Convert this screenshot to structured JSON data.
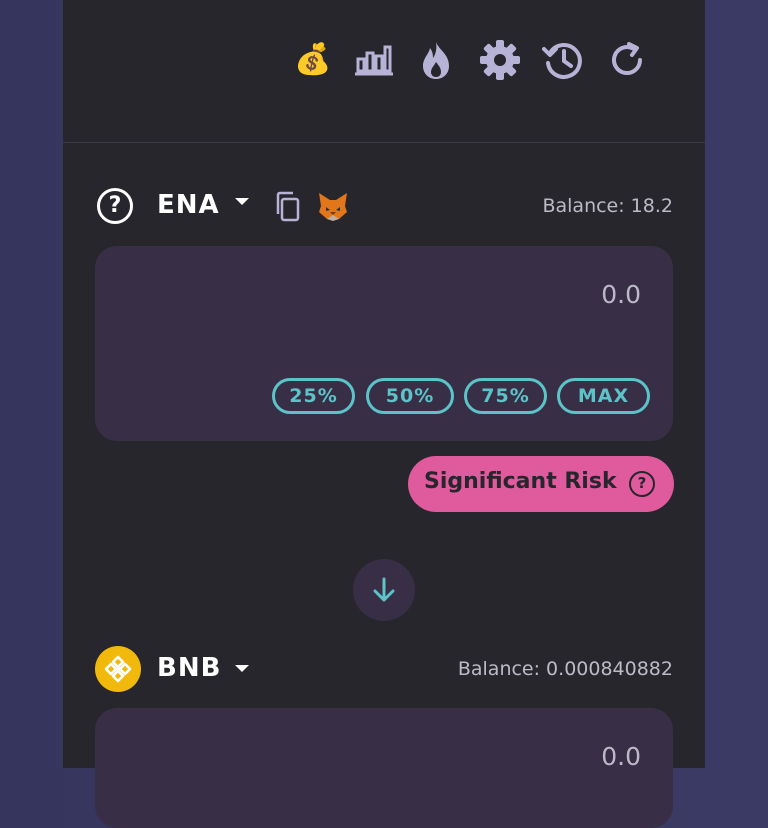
{
  "toolbar": {
    "icons": [
      "money-bag-icon",
      "chart-icon",
      "flame-icon",
      "gear-icon",
      "history-icon",
      "refresh-icon"
    ]
  },
  "from": {
    "token": "ENA",
    "balance": "Balance: 18.2",
    "amount": "0.0",
    "percent_buttons": [
      "25%",
      "50%",
      "75%",
      "MAX"
    ]
  },
  "risk": {
    "label": "Significant Risk"
  },
  "to": {
    "token": "BNB",
    "balance": "Balance: 0.000840882",
    "amount": "0.0"
  },
  "colors": {
    "background": "#35355e",
    "panel": "#27262c",
    "input": "#382f47",
    "accent_teal": "#5cc4c9",
    "risk_pink": "#e05a9e",
    "icon_lavender": "#b7b3d6",
    "bnb_yellow": "#f0b90b"
  }
}
